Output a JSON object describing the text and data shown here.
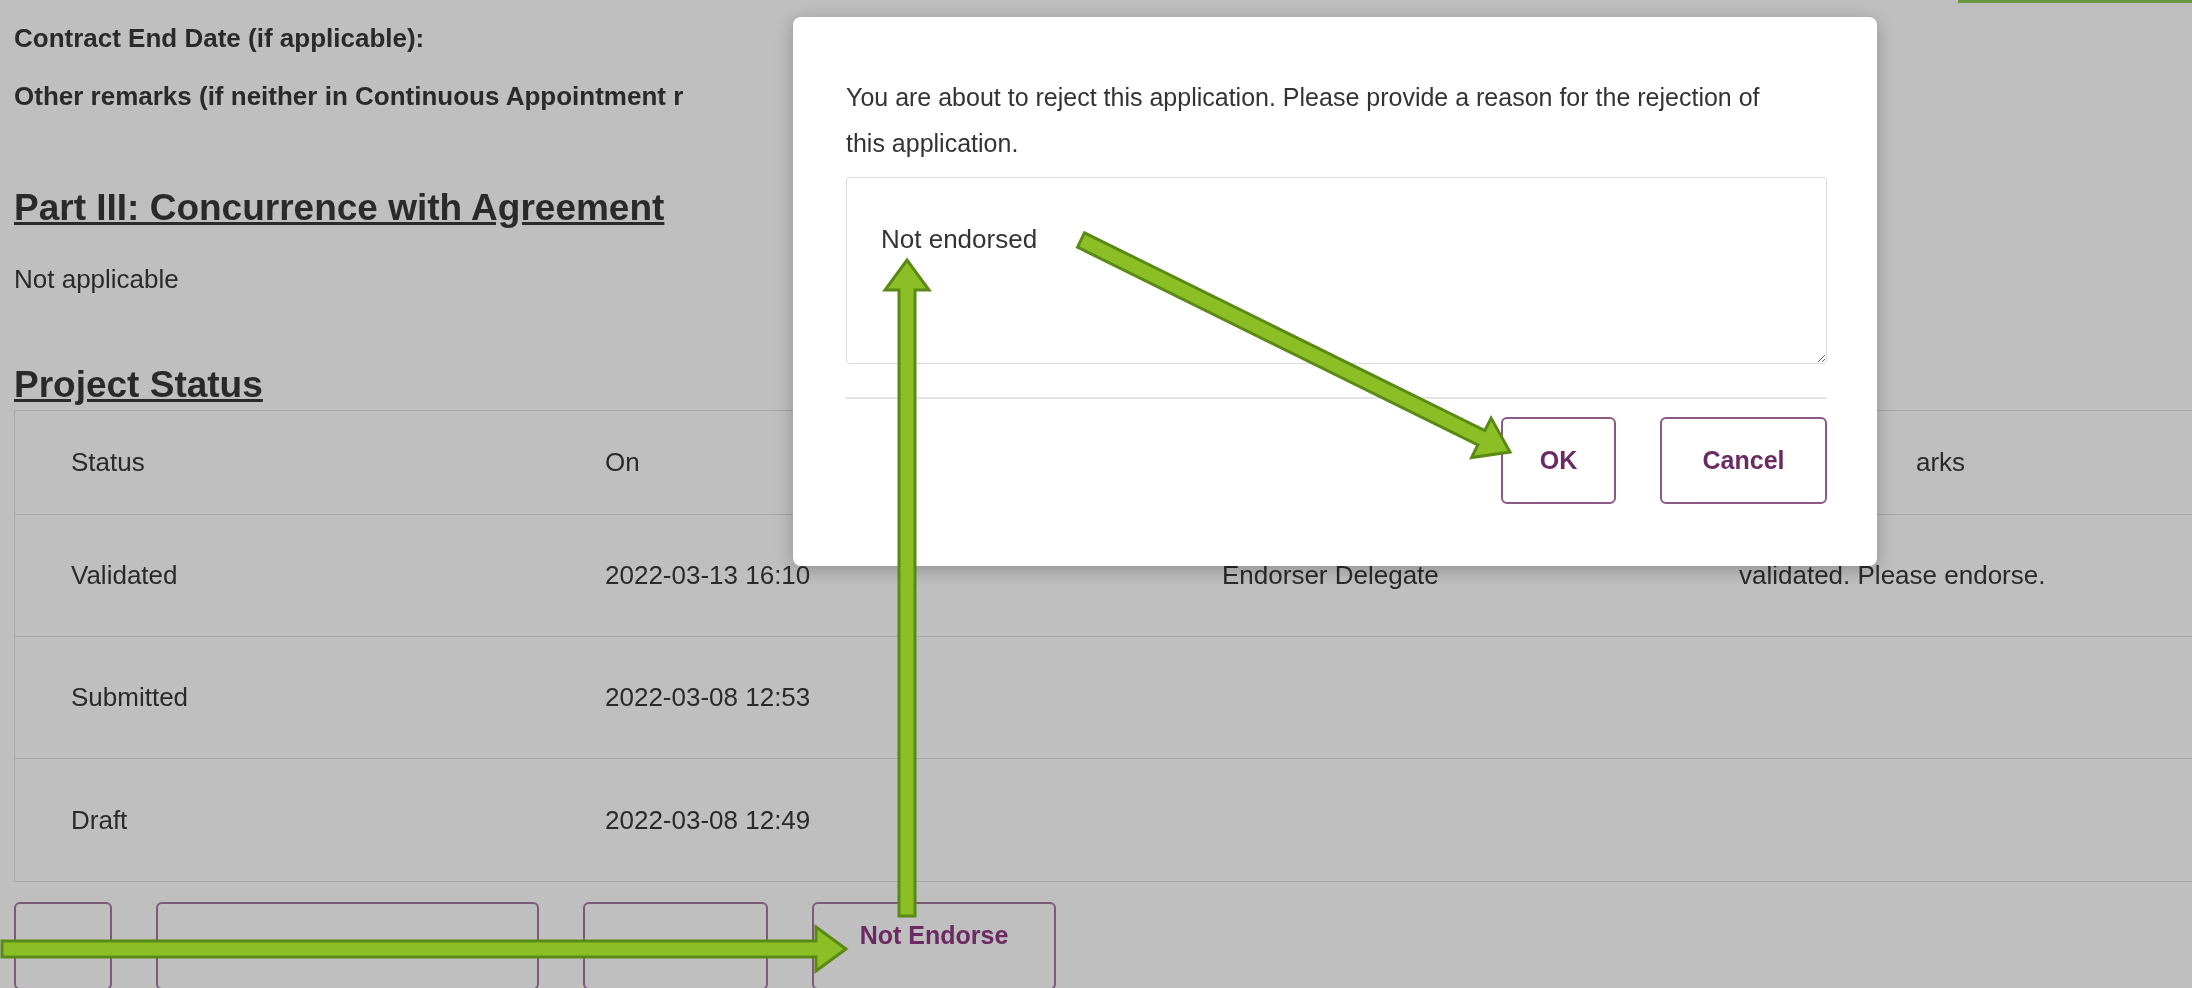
{
  "fields": [
    {
      "label": "Contract End Date (if applicable):"
    },
    {
      "label": "Other remarks (if neither in Continuous Appointment r"
    }
  ],
  "part_iii": {
    "heading": "Part III: Concurrence with Agreement",
    "text": "Not applicable"
  },
  "project_status": {
    "heading": "Project Status",
    "columns": [
      "Status",
      "On",
      "",
      "arks"
    ],
    "rows": [
      {
        "cells": [
          "Validated",
          "2022-03-13 16:10",
          "Endorser Delegate",
          "validated. Please endorse."
        ]
      },
      {
        "cells": [
          "Submitted",
          "2022-03-08 12:53",
          "",
          ""
        ]
      },
      {
        "cells": [
          "Draft",
          "2022-03-08 12:49",
          "",
          ""
        ]
      }
    ]
  },
  "actions": [
    {
      "kind": "covered"
    },
    {
      "kind": "covered"
    },
    {
      "kind": "covered"
    },
    {
      "kind": "labelled",
      "label": "Not Endorse"
    }
  ],
  "dialog": {
    "message": "You are about to reject this application. Please provide a reason for the rejection of this application.",
    "reason": "Not endorsed",
    "buttons": [
      "OK",
      "Cancel"
    ]
  }
}
